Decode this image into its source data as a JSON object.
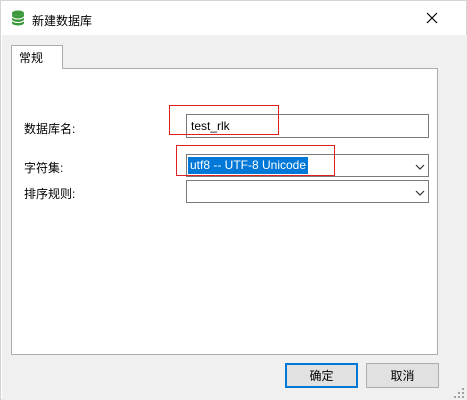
{
  "window": {
    "title": "新建数据库",
    "title_icon": "database-icon",
    "close_icon": "close-icon"
  },
  "tabs": [
    {
      "label": "常规",
      "active": true
    }
  ],
  "form": {
    "db_name_label": "数据库名:",
    "db_name_value": "test_rlk",
    "charset_label": "字符集:",
    "charset_value": "utf8 -- UTF-8 Unicode",
    "collation_label": "排序规则:",
    "collation_value": ""
  },
  "buttons": {
    "ok_label": "确定",
    "cancel_label": "取消"
  },
  "colors": {
    "selection": "#0078d7",
    "annotation": "#e02020",
    "database_icon": "#3c9a3c"
  }
}
